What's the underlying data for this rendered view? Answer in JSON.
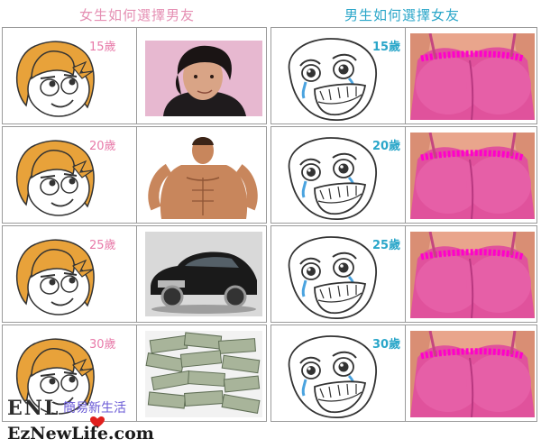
{
  "header": {
    "left_title": "女生如何選擇男友",
    "right_title": "男生如何選擇女友"
  },
  "left_rows": [
    {
      "age": "15歲",
      "picture": "teen-idol-photo"
    },
    {
      "age": "20歲",
      "picture": "muscular-man-photo"
    },
    {
      "age": "25歲",
      "picture": "luxury-car-photo"
    },
    {
      "age": "30歲",
      "picture": "money-pile-photo"
    }
  ],
  "right_rows": [
    {
      "age": "15歲",
      "picture": "pink-top-photo"
    },
    {
      "age": "20歲",
      "picture": "pink-top-photo"
    },
    {
      "age": "25歲",
      "picture": "pink-top-photo"
    },
    {
      "age": "30歲",
      "picture": "pink-top-photo"
    }
  ],
  "watermark": {
    "logo": "ENL",
    "chinese": "簡易新生活",
    "url": "EzNewLife.com"
  },
  "colors": {
    "left_accent": "#e58fb3",
    "right_accent": "#2aa6c9",
    "hair": "#e8a23a",
    "pink": "#d93a8c"
  }
}
